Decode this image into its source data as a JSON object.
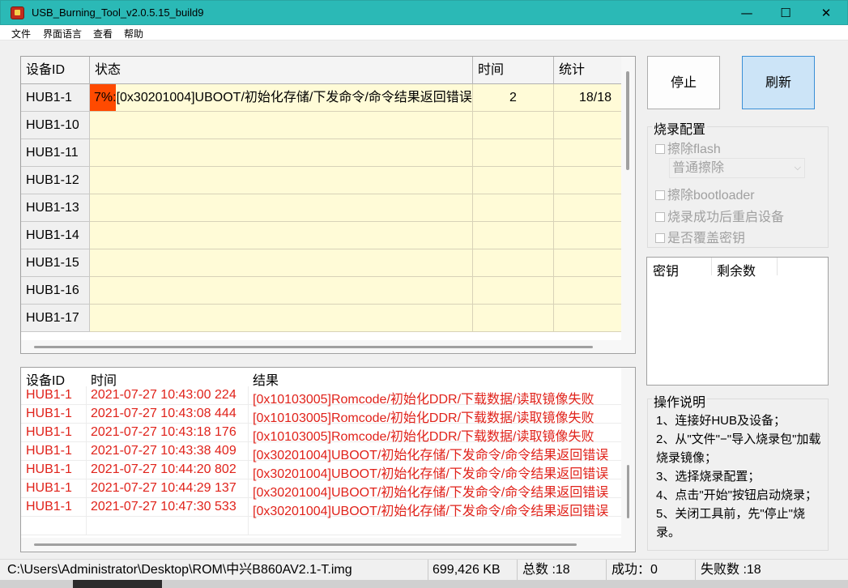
{
  "window": {
    "title": "USB_Burning_Tool_v2.0.5.15_build9",
    "minimize": "—",
    "maximize": "☐",
    "close": "✕"
  },
  "menu": [
    "文件",
    "界面语言",
    "查看",
    "帮助"
  ],
  "device_grid": {
    "columns": [
      "设备ID",
      "状态",
      "时间",
      "统计"
    ],
    "rows": [
      {
        "id": "HUB1-1",
        "progress": "7%",
        "progress_value": 0.07,
        "status": "[0x30201004]UBOOT/初始化存储/下发命令/命令结果返回错误",
        "time": "2",
        "stat": "18/18"
      },
      {
        "id": "HUB1-10",
        "progress": "",
        "status": "",
        "time": "",
        "stat": ""
      },
      {
        "id": "HUB1-11",
        "progress": "",
        "status": "",
        "time": "",
        "stat": ""
      },
      {
        "id": "HUB1-12",
        "progress": "",
        "status": "",
        "time": "",
        "stat": ""
      },
      {
        "id": "HUB1-13",
        "progress": "",
        "status": "",
        "time": "",
        "stat": ""
      },
      {
        "id": "HUB1-14",
        "progress": "",
        "status": "",
        "time": "",
        "stat": ""
      },
      {
        "id": "HUB1-15",
        "progress": "",
        "status": "",
        "time": "",
        "stat": ""
      },
      {
        "id": "HUB1-16",
        "progress": "",
        "status": "",
        "time": "",
        "stat": ""
      },
      {
        "id": "HUB1-17",
        "progress": "",
        "status": "",
        "time": "",
        "stat": ""
      }
    ]
  },
  "log": {
    "columns": [
      "设备ID",
      "时间",
      "结果"
    ],
    "rows": [
      {
        "id": "HUB1-1",
        "time": "2021-07-27 10:43:00 224",
        "result": "[0x10103005]Romcode/初始化DDR/下载数据/读取镜像失败"
      },
      {
        "id": "HUB1-1",
        "time": "2021-07-27 10:43:08 444",
        "result": "[0x10103005]Romcode/初始化DDR/下载数据/读取镜像失败"
      },
      {
        "id": "HUB1-1",
        "time": "2021-07-27 10:43:18 176",
        "result": "[0x10103005]Romcode/初始化DDR/下载数据/读取镜像失败"
      },
      {
        "id": "HUB1-1",
        "time": "2021-07-27 10:43:38 409",
        "result": "[0x30201004]UBOOT/初始化存储/下发命令/命令结果返回错误"
      },
      {
        "id": "HUB1-1",
        "time": "2021-07-27 10:44:20 802",
        "result": "[0x30201004]UBOOT/初始化存储/下发命令/命令结果返回错误"
      },
      {
        "id": "HUB1-1",
        "time": "2021-07-27 10:44:29 137",
        "result": "[0x30201004]UBOOT/初始化存储/下发命令/命令结果返回错误"
      },
      {
        "id": "HUB1-1",
        "time": "2021-07-27 10:47:30 533",
        "result": "[0x30201004]UBOOT/初始化存储/下发命令/命令结果返回错误"
      }
    ]
  },
  "buttons": {
    "stop": "停止",
    "refresh": "刷新"
  },
  "burn_config": {
    "title": "烧录配置",
    "erase_flash": "擦除flash",
    "erase_mode": "普通擦除",
    "erase_bootloader": "擦除bootloader",
    "reboot_after": "烧录成功后重启设备",
    "overwrite_key": "是否覆盖密钥"
  },
  "key_list": {
    "columns": [
      "密钥",
      "剩余数"
    ]
  },
  "operations": {
    "title": "操作说明",
    "text": "1、连接好HUB及设备；\n2、从\"文件\"−\"导入烧录包\"加载烧录镜像；\n3、选择烧录配置；\n4、点击\"开始\"按钮启动烧录；\n5、关闭工具前，先\"停止\"烧录。"
  },
  "status_bar": {
    "path": "C:\\Users\\Administrator\\Desktop\\ROM\\中兴B860AV2.1-T.img",
    "size": "699,426 KB",
    "total": "总数 :18",
    "success": "成功：0",
    "fail": "失败数 :18"
  },
  "colors": {
    "accent_titlebar": "#2bb9b6",
    "progress": "#ff4a00",
    "grid_bg": "#fffbd7",
    "log_text": "#e0221a"
  }
}
